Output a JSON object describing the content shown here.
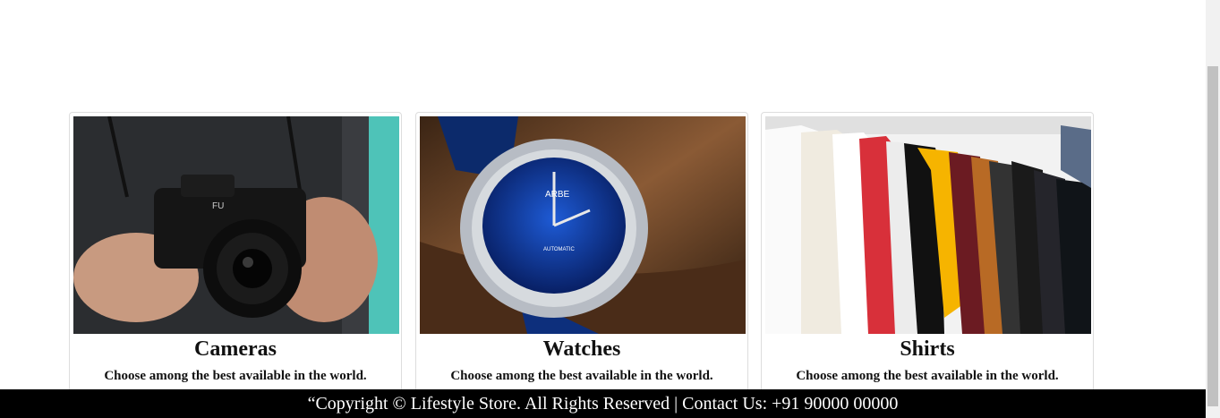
{
  "products": [
    {
      "title": "Cameras",
      "description": "Choose among the best available in the world.",
      "image": "camera-photo"
    },
    {
      "title": "Watches",
      "description": "Choose among the best available in the world.",
      "image": "watch-photo"
    },
    {
      "title": "Shirts",
      "description": "Choose among the best available in the world.",
      "image": "shirts-photo"
    }
  ],
  "footer": {
    "text": "“Copyright © Lifestyle Store. All Rights Reserved | Contact Us: +91 90000 00000"
  },
  "colors": {
    "footer_bg": "#000000",
    "footer_text": "#ffffff",
    "card_border": "#dddddd"
  }
}
